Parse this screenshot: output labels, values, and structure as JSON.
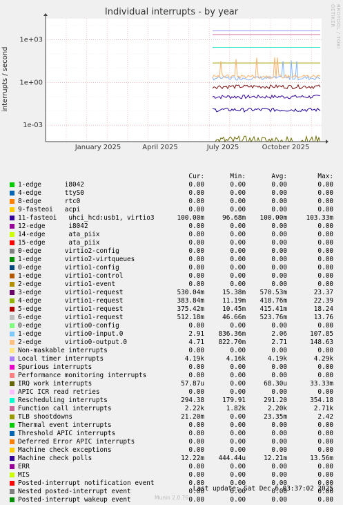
{
  "chart_data": {
    "type": "line",
    "title": "Individual interrupts - by year",
    "ylabel": "interrupts / second",
    "yscale": "log",
    "ylim": [
      7e-05,
      30000
    ],
    "yticks": [
      "1e+03",
      "1e+00",
      "1e-03"
    ],
    "xticks": [
      "January 2025",
      "April 2025",
      "July 2025",
      "October 2025"
    ],
    "grid": true,
    "series": [
      {
        "name": "Local timer interrupts",
        "color": "#a3a3f0",
        "level": 4190
      },
      {
        "name": "Function call interrupts",
        "color": "#cc6699",
        "level": 2220
      },
      {
        "name": "TLB shootdowns",
        "color": "#a3a300",
        "level": 23.35
      },
      {
        "name": "Rescheduling interrupts",
        "color": "#1ce6c6",
        "level": 291.2
      },
      {
        "name": "11-fasteoi uhci_hcd:usb1, virtio3",
        "color": "#330099",
        "level": 0.1
      },
      {
        "name": "virtio0-input.0",
        "color": "#80b2ff",
        "level": 2.06
      },
      {
        "name": "virtio0-output.0",
        "color": "#f7b26e",
        "level": 2.71
      },
      {
        "name": "virtio1-request",
        "color": "#7a0a0a",
        "level": 0.52
      },
      {
        "name": "Machine check polls",
        "color": "#200099",
        "level": 0.01221
      },
      {
        "name": "IRQ work interrupts",
        "color": "#6b6b00",
        "level": 6.83e-05
      }
    ]
  },
  "legend_header": {
    "cur": "Cur:",
    "min": "Min:",
    "avg": "Avg:",
    "max": "Max:"
  },
  "legend": [
    {
      "label": "1-edge      i8042",
      "color": "#00cc00",
      "cur": "0.00",
      "min": "0.00",
      "avg": "0.00",
      "max": "0.00"
    },
    {
      "label": "4-edge      ttyS0",
      "color": "#0066b3",
      "cur": "0.00",
      "min": "0.00",
      "avg": "0.00",
      "max": "0.00"
    },
    {
      "label": "8-edge      rtc0",
      "color": "#ff8000",
      "cur": "0.00",
      "min": "0.00",
      "avg": "0.00",
      "max": "0.00"
    },
    {
      "label": "9-fasteoi   acpi",
      "color": "#ffcc00",
      "cur": "0.00",
      "min": "0.00",
      "avg": "0.00",
      "max": "0.00"
    },
    {
      "label": "11-fasteoi   uhci_hcd:usb1, virtio3",
      "color": "#330099",
      "cur": "100.00m",
      "min": "96.68m",
      "avg": "100.00m",
      "max": "103.33m"
    },
    {
      "label": "12-edge      i8042",
      "color": "#990099",
      "cur": "0.00",
      "min": "0.00",
      "avg": "0.00",
      "max": "0.00"
    },
    {
      "label": "14-edge      ata_piix",
      "color": "#ccff00",
      "cur": "0.00",
      "min": "0.00",
      "avg": "0.00",
      "max": "0.00"
    },
    {
      "label": "15-edge      ata_piix",
      "color": "#ff0000",
      "cur": "0.00",
      "min": "0.00",
      "avg": "0.00",
      "max": "0.00"
    },
    {
      "label": "0-edge      virtio2-config",
      "color": "#808080",
      "cur": "0.00",
      "min": "0.00",
      "avg": "0.00",
      "max": "0.00"
    },
    {
      "label": "1-edge      virtio2-virtqueues",
      "color": "#008f00",
      "cur": "0.00",
      "min": "0.00",
      "avg": "0.00",
      "max": "0.00"
    },
    {
      "label": "0-edge      virtio1-config",
      "color": "#00487d",
      "cur": "0.00",
      "min": "0.00",
      "avg": "0.00",
      "max": "0.00"
    },
    {
      "label": "1-edge      virtio1-control",
      "color": "#b35a00",
      "cur": "0.00",
      "min": "0.00",
      "avg": "0.00",
      "max": "0.00"
    },
    {
      "label": "2-edge      virtio1-event",
      "color": "#b38f00",
      "cur": "0.00",
      "min": "0.00",
      "avg": "0.00",
      "max": "0.00"
    },
    {
      "label": "3-edge      virtio1-request",
      "color": "#6b006b",
      "cur": "530.04m",
      "min": "15.38m",
      "avg": "570.53m",
      "max": "23.37"
    },
    {
      "label": "4-edge      virtio1-request",
      "color": "#8fb300",
      "cur": "383.84m",
      "min": "11.19m",
      "avg": "418.76m",
      "max": "22.39"
    },
    {
      "label": "5-edge      virtio1-request",
      "color": "#b30000",
      "cur": "375.42m",
      "min": "10.45m",
      "avg": "415.41m",
      "max": "18.24"
    },
    {
      "label": "6-edge      virtio1-request",
      "color": "#bebebe",
      "cur": "512.18m",
      "min": "46.66m",
      "avg": "523.76m",
      "max": "13.76"
    },
    {
      "label": "0-edge      virtio0-config",
      "color": "#80ff80",
      "cur": "0.00",
      "min": "0.00",
      "avg": "0.00",
      "max": "0.00"
    },
    {
      "label": "1-edge      virtio0-input.0",
      "color": "#80c9ff",
      "cur": "2.91",
      "min": "836.36m",
      "avg": "2.06",
      "max": "107.85"
    },
    {
      "label": "2-edge      virtio0-output.0",
      "color": "#ffc080",
      "cur": "4.71",
      "min": "822.70m",
      "avg": "2.71",
      "max": "148.63"
    },
    {
      "label": "Non-maskable interrupts",
      "color": "#ffe680",
      "cur": "0.00",
      "min": "0.00",
      "avg": "0.00",
      "max": "0.00"
    },
    {
      "label": "Local timer interrupts",
      "color": "#aa80ff",
      "cur": "4.19k",
      "min": "4.16k",
      "avg": "4.19k",
      "max": "4.29k"
    },
    {
      "label": "Spurious interrupts",
      "color": "#ee00cc",
      "cur": "0.00",
      "min": "0.00",
      "avg": "0.00",
      "max": "0.00"
    },
    {
      "label": "Performance monitoring interrupts",
      "color": "#ff8080",
      "cur": "0.00",
      "min": "0.00",
      "avg": "0.00",
      "max": "0.00"
    },
    {
      "label": "IRQ work interrupts",
      "color": "#666600",
      "cur": "57.87u",
      "min": "0.00",
      "avg": "68.30u",
      "max": "33.33m"
    },
    {
      "label": "APIC ICR read retries",
      "color": "#ffbfff",
      "cur": "0.00",
      "min": "0.00",
      "avg": "0.00",
      "max": "0.00"
    },
    {
      "label": "Rescheduling interrupts",
      "color": "#00ffcc",
      "cur": "294.38",
      "min": "179.91",
      "avg": "291.20",
      "max": "354.18"
    },
    {
      "label": "Function call interrupts",
      "color": "#cc6699",
      "cur": "2.22k",
      "min": "1.82k",
      "avg": "2.20k",
      "max": "2.71k"
    },
    {
      "label": "TLB shootdowns",
      "color": "#999900",
      "cur": "21.20m",
      "min": "0.00",
      "avg": "23.35m",
      "max": "2.42"
    },
    {
      "label": "Thermal event interrupts",
      "color": "#00cc00",
      "cur": "0.00",
      "min": "0.00",
      "avg": "0.00",
      "max": "0.00"
    },
    {
      "label": "Threshold APIC interrupts",
      "color": "#0066b3",
      "cur": "0.00",
      "min": "0.00",
      "avg": "0.00",
      "max": "0.00"
    },
    {
      "label": "Deferred Error APIC interrupts",
      "color": "#ff8000",
      "cur": "0.00",
      "min": "0.00",
      "avg": "0.00",
      "max": "0.00"
    },
    {
      "label": "Machine check exceptions",
      "color": "#ffcc00",
      "cur": "0.00",
      "min": "0.00",
      "avg": "0.00",
      "max": "0.00"
    },
    {
      "label": "Machine check polls",
      "color": "#330099",
      "cur": "12.22m",
      "min": "444.44u",
      "avg": "12.21m",
      "max": "13.56m"
    },
    {
      "label": "ERR",
      "color": "#990099",
      "cur": "0.00",
      "min": "0.00",
      "avg": "0.00",
      "max": "0.00"
    },
    {
      "label": "MIS",
      "color": "#ccff00",
      "cur": "0.00",
      "min": "0.00",
      "avg": "0.00",
      "max": "0.00"
    },
    {
      "label": "Posted-interrupt notification event",
      "color": "#ff0000",
      "cur": "0.00",
      "min": "0.00",
      "avg": "0.00",
      "max": "0.00"
    },
    {
      "label": "Nested posted-interrupt event",
      "color": "#808080",
      "cur": "0.00",
      "min": "0.00",
      "avg": "0.00",
      "max": "0.00"
    },
    {
      "label": "Posted-interrupt wakeup event",
      "color": "#008f00",
      "cur": "0.00",
      "min": "0.00",
      "avg": "0.00",
      "max": "0.00"
    }
  ],
  "footer": {
    "last_update": "Last update: Sat Dec  6 03:37:02 2025",
    "generator": "Munin 2.0.76",
    "watermark": "RRDTOOL / TOBI OETIKER"
  }
}
